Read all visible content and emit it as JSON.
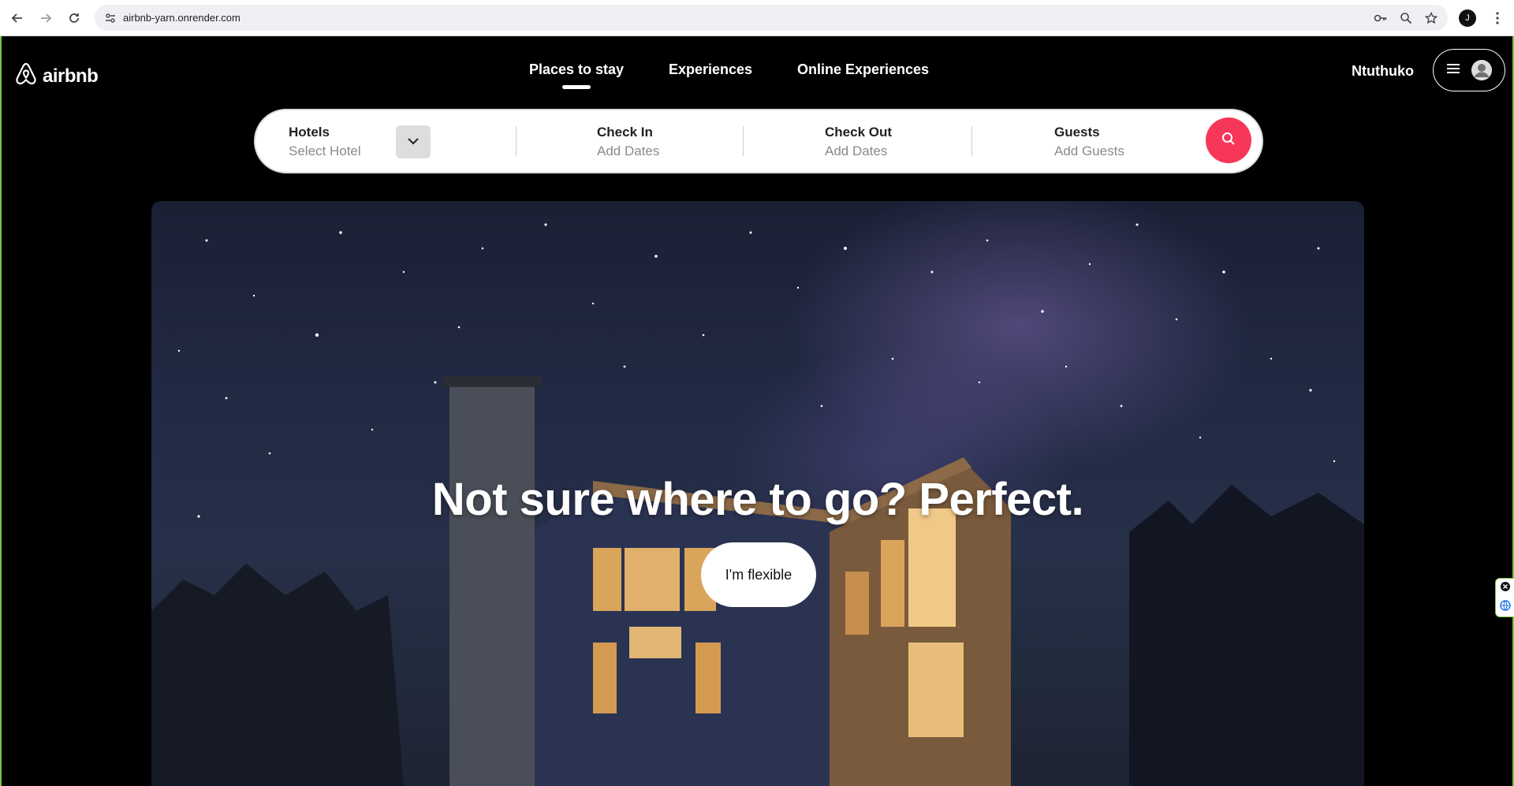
{
  "browser": {
    "url": "airbnb-yarn.onrender.com",
    "profile_initial": "J"
  },
  "header": {
    "logo_text": "airbnb",
    "tabs": [
      {
        "label": "Places to stay",
        "active": true
      },
      {
        "label": "Experiences",
        "active": false
      },
      {
        "label": "Online Experiences",
        "active": false
      }
    ],
    "username": "Ntuthuko"
  },
  "search": {
    "hotels_label": "Hotels",
    "hotels_value": "Select Hotel",
    "checkin_label": "Check In",
    "checkin_value": "Add Dates",
    "checkout_label": "Check Out",
    "checkout_value": "Add Dates",
    "guests_label": "Guests",
    "guests_value": "Add Guests"
  },
  "hero": {
    "headline": "Not sure where to go? Perfect.",
    "button_label": "I'm flexible"
  },
  "colors": {
    "accent": "#f7375a",
    "background": "#000000"
  }
}
